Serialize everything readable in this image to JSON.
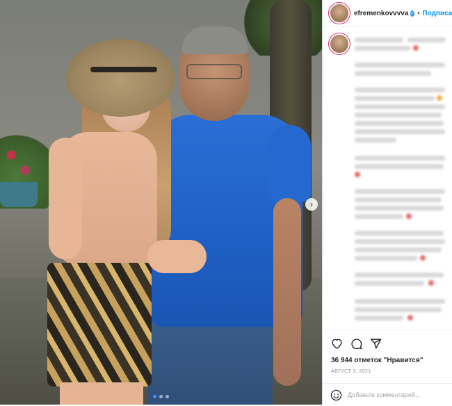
{
  "header": {
    "username": "efremenkovvvva",
    "separator": "•",
    "follow_label": "Подписаться"
  },
  "carousel": {
    "slide_count": 3,
    "active_index": 0
  },
  "actions": {
    "icons": [
      "heart-icon",
      "comment-icon",
      "share-icon"
    ],
    "likes_text": "36 944 отметок \"Нравится\"",
    "date_text": "АВГУСТ 3, 2021"
  },
  "comment": {
    "placeholder": "Добавьте комментарий..."
  },
  "colors": {
    "accent": "#0095f6",
    "verified": "#3897f0",
    "story_ring": "#d62976"
  }
}
